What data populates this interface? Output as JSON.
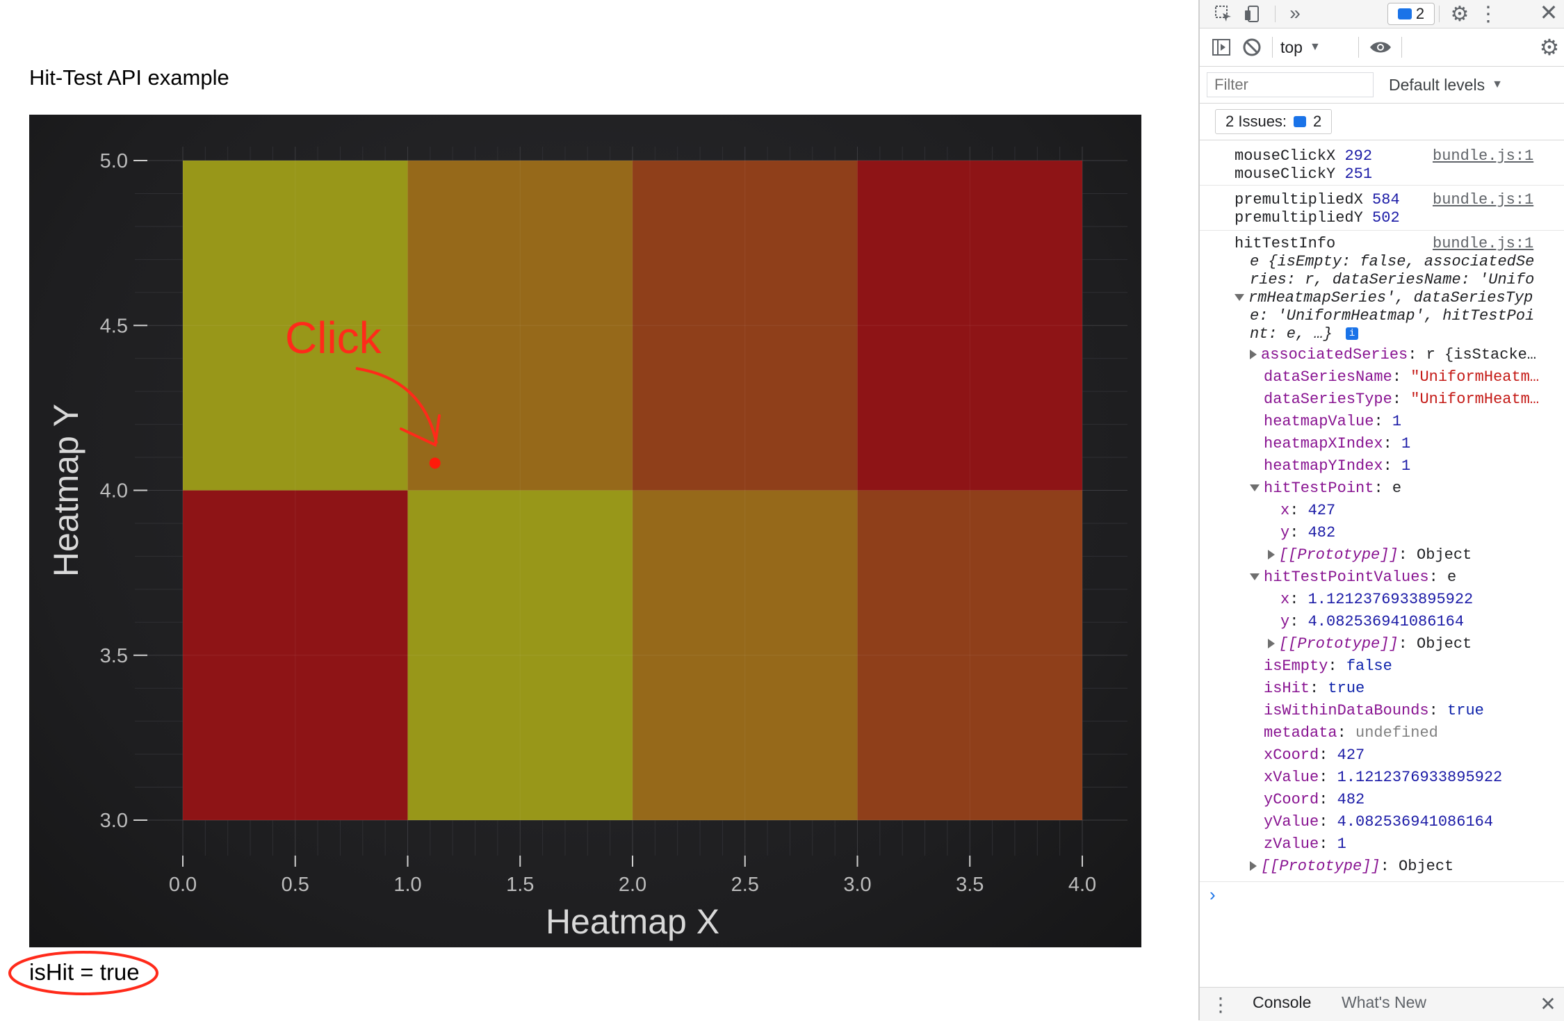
{
  "page": {
    "title": "Hit-Test API example",
    "result_text": "isHit = true"
  },
  "annotation": {
    "click_label": "Click"
  },
  "colors": {
    "red": "#8e1416",
    "olive": "#989719",
    "brown": "#96691a",
    "rust": "#8f3f1a",
    "annotation": "#ff2a1a"
  },
  "chart_data": {
    "type": "heatmap",
    "xlabel": "Heatmap X",
    "ylabel": "Heatmap Y",
    "xlim": [
      0.0,
      4.0
    ],
    "ylim": [
      3.0,
      5.0
    ],
    "x_ticks": [
      "0.0",
      "0.5",
      "1.0",
      "1.5",
      "2.0",
      "2.5",
      "3.0",
      "3.5",
      "4.0"
    ],
    "y_ticks": [
      "3.0",
      "3.5",
      "4.0",
      "4.5",
      "5.0"
    ],
    "x_edges": [
      0,
      1,
      2,
      3,
      4
    ],
    "y_edges": [
      3,
      4,
      5
    ],
    "cells": [
      {
        "x0": 0,
        "x1": 1,
        "y0": 4,
        "y1": 5,
        "color": "#989719"
      },
      {
        "x0": 1,
        "x1": 2,
        "y0": 4,
        "y1": 5,
        "color": "#96691a"
      },
      {
        "x0": 2,
        "x1": 3,
        "y0": 4,
        "y1": 5,
        "color": "#8f3f1a"
      },
      {
        "x0": 3,
        "x1": 4,
        "y0": 4,
        "y1": 5,
        "color": "#8e1416"
      },
      {
        "x0": 0,
        "x1": 1,
        "y0": 3,
        "y1": 4,
        "color": "#8e1416"
      },
      {
        "x0": 1,
        "x1": 2,
        "y0": 3,
        "y1": 4,
        "color": "#989719"
      },
      {
        "x0": 2,
        "x1": 3,
        "y0": 3,
        "y1": 4,
        "color": "#96691a"
      },
      {
        "x0": 3,
        "x1": 4,
        "y0": 3,
        "y1": 4,
        "color": "#8f3f1a"
      }
    ],
    "click_point": {
      "x": 1.1212376933895922,
      "y": 4.082536941086164
    },
    "grid": true,
    "legend": "none"
  },
  "devtools": {
    "toolbar": {
      "badge_count": "2"
    },
    "console_toolbar": {
      "context": "top",
      "filter_placeholder": "Filter",
      "levels": "Default levels"
    },
    "issues": {
      "label": "2 Issues:",
      "count": "2"
    },
    "source": "bundle.js:1",
    "logs": {
      "mouse_x_key": "mouseClickX",
      "mouse_x_val": "292",
      "mouse_y_key": "mouseClickY",
      "mouse_y_val": "251",
      "pre_x_key": "premultipliedX",
      "pre_x_val": "584",
      "pre_y_key": "premultipliedY",
      "pre_y_val": "502",
      "hit_label": "hitTestInfo"
    },
    "summary_lines": [
      "e {isEmpty: false, associatedSe",
      "ries: r, dataSeriesName: 'Unifo",
      "rmHeatmapSeries', dataSeriesTyp",
      "e: 'UniformHeatmap', hitTestPoi",
      "nt: e, …}"
    ],
    "props": {
      "assoc_key": "associatedSeries",
      "assoc_val": "r {isStacke…",
      "dsname_key": "dataSeriesName",
      "dsname_val": "\"UniformHeatm…",
      "dstype_key": "dataSeriesType",
      "dstype_val": "\"UniformHeatm…",
      "hmval_key": "heatmapValue",
      "hmval_val": "1",
      "hmx_key": "heatmapXIndex",
      "hmx_val": "1",
      "hmy_key": "heatmapYIndex",
      "hmy_val": "1",
      "htp_key": "hitTestPoint",
      "htp_val": "e",
      "htp_x_key": "x",
      "htp_x_val": "427",
      "htp_y_key": "y",
      "htp_y_val": "482",
      "proto_key": "[[Prototype]]",
      "proto_val": "Object",
      "htpv_key": "hitTestPointValues",
      "htpv_val": "e",
      "htpv_x_key": "x",
      "htpv_x_val": "1.1212376933895922",
      "htpv_y_key": "y",
      "htpv_y_val": "4.082536941086164",
      "isempty_key": "isEmpty",
      "isempty_val": "false",
      "ishit_key": "isHit",
      "ishit_val": "true",
      "within_key": "isWithinDataBounds",
      "within_val": "true",
      "meta_key": "metadata",
      "meta_val": "undefined",
      "xcoord_key": "xCoord",
      "xcoord_val": "427",
      "xvalue_key": "xValue",
      "xvalue_val": "1.1212376933895922",
      "ycoord_key": "yCoord",
      "ycoord_val": "482",
      "yvalue_key": "yValue",
      "yvalue_val": "4.082536941086164",
      "zvalue_key": "zValue",
      "zvalue_val": "1"
    },
    "drawer": {
      "tab_console": "Console",
      "tab_whats_new": "What's New"
    }
  }
}
